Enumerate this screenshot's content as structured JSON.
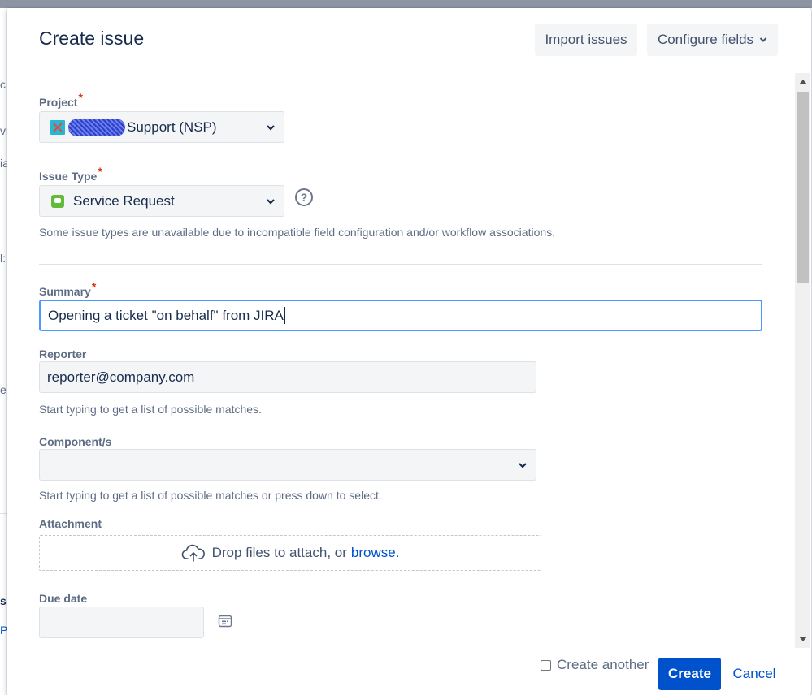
{
  "dialog": {
    "title": "Create issue",
    "import_label": "Import issues",
    "configure_label": "Configure fields"
  },
  "fields": {
    "project": {
      "label": "Project",
      "required_marker": "*",
      "value": "Support (NSP)"
    },
    "issue_type": {
      "label": "Issue Type",
      "required_marker": "*",
      "value": "Service Request",
      "help_glyph": "?",
      "note": "Some issue types are unavailable due to incompatible field configuration and/or workflow associations."
    },
    "summary": {
      "label": "Summary",
      "required_marker": "*",
      "value": "Opening a ticket \"on behalf\" from JIRA"
    },
    "reporter": {
      "label": "Reporter",
      "value": "reporter@company.com",
      "hint": "Start typing to get a list of possible matches."
    },
    "components": {
      "label": "Component/s",
      "value": "",
      "hint": "Start typing to get a list of possible matches or press down to select."
    },
    "attachment": {
      "label": "Attachment",
      "drop_text": "Drop files to attach, or",
      "browse_text": "browse."
    },
    "due_date": {
      "label": "Due date",
      "value": ""
    }
  },
  "footer": {
    "create_another_label": "Create another",
    "create_another_checked": false,
    "create_label": "Create",
    "cancel_label": "Cancel"
  },
  "background": {
    "fragments": [
      "c",
      "vi",
      "ia",
      "l:",
      "e",
      "s",
      "P"
    ]
  },
  "icons": {
    "configure_chevron": "chevron-down-icon",
    "select_dropdown": "chevron-down-icon",
    "help": "question-circle-icon",
    "upload": "cloud-upload-icon",
    "calendar": "calendar-icon"
  },
  "colors": {
    "primary": "#0052cc",
    "focus_border": "#4c9aff",
    "required": "#de350b",
    "issue_type_green": "#63ba3c",
    "field_bg": "#f4f5f7"
  }
}
